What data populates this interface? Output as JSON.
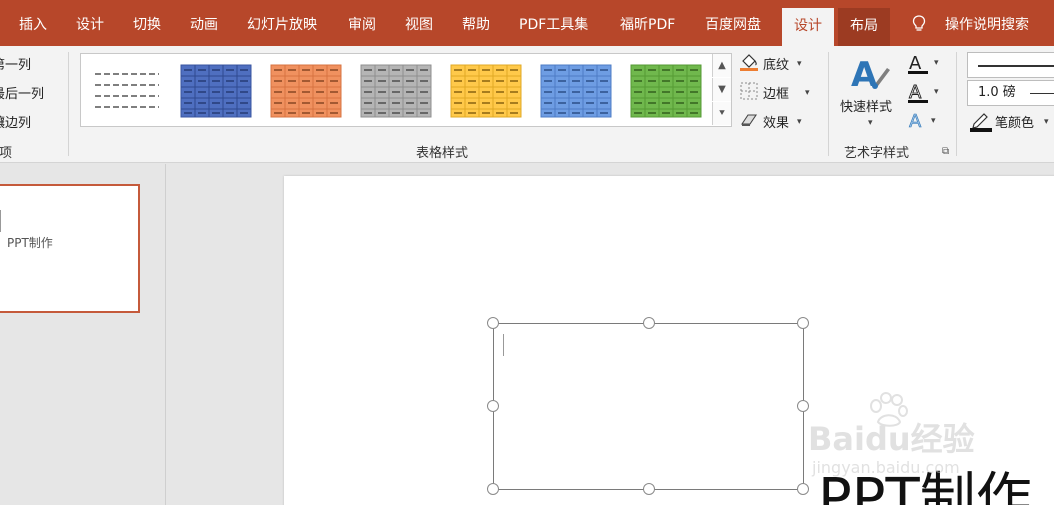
{
  "menu": {
    "tabs": [
      "插入",
      "设计",
      "切换",
      "动画",
      "幻灯片放映",
      "审阅",
      "视图",
      "帮助",
      "PDF工具集",
      "福昕PDF",
      "百度网盘",
      "设计",
      "布局"
    ],
    "search_label": "操作说明搜索"
  },
  "ribbon": {
    "options": [
      "第一列",
      "最后一列",
      "镶边列"
    ],
    "options_group": "项",
    "table_styles_group": "表格样式",
    "shading_label": "底纹",
    "border_label": "边框",
    "effects_label": "效果",
    "quick_styles_label": "快速样式",
    "art_group": "艺术字样式",
    "pen_weight": "1.0 磅",
    "pen_color_label": "笔颜色",
    "style_colors": [
      "none",
      "#4f6fc0",
      "#f0915f",
      "#a9a9a9",
      "#ffc94a",
      "#6e9de3",
      "#70b84d"
    ]
  },
  "thumbnail": {
    "text": "PPT制作"
  },
  "slide": {
    "text": "PPT制作"
  },
  "watermark": {
    "brand": "Baidu经验",
    "url": "jingyan.baidu.com"
  },
  "colors": {
    "accent": "#b7472a",
    "active_tab_bg": "#f3f3f3"
  }
}
